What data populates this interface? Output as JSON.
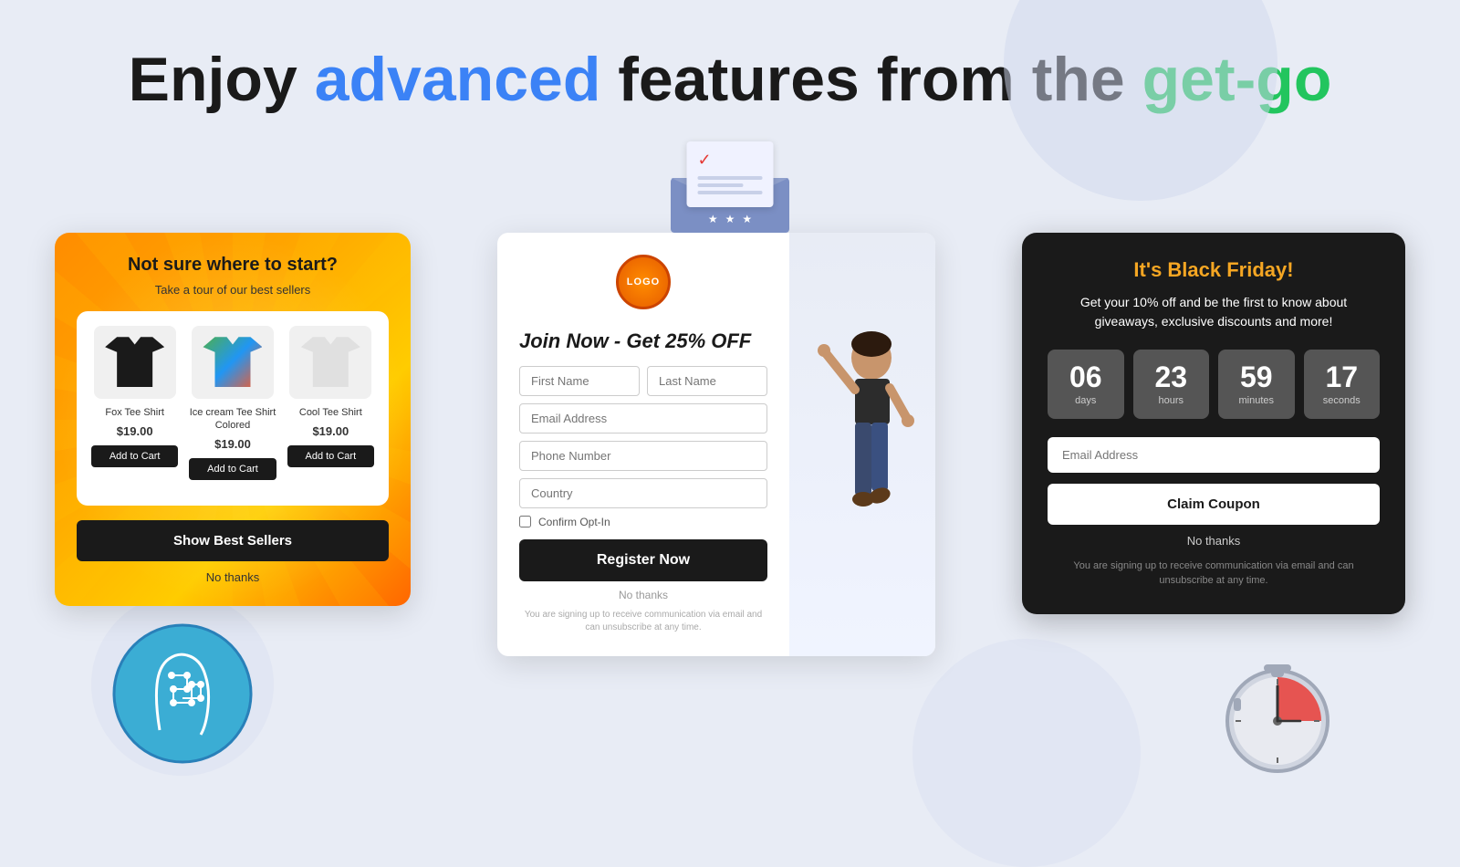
{
  "header": {
    "title_plain": "Enjoy ",
    "title_blue": "advanced",
    "title_mid": " features from the ",
    "title_green": "get-go"
  },
  "left_card": {
    "heading": "Not sure where to start?",
    "subheading": "Take a tour of our best sellers",
    "products": [
      {
        "name": "Fox Tee Shirt",
        "price": "$19.00",
        "color": "black"
      },
      {
        "name": "Ice cream Tee Shirt Colored",
        "price": "$19.00",
        "color": "colorful"
      },
      {
        "name": "Cool Tee Shirt",
        "price": "$19.00",
        "color": "light"
      }
    ],
    "add_to_cart_label": "Add to Cart",
    "show_sellers_label": "Show Best Sellers",
    "no_thanks_label": "No thanks"
  },
  "center_card": {
    "logo_text": "LOGO",
    "title": "Join Now - Get 25% OFF",
    "fields": {
      "first_name": "First Name",
      "last_name": "Last Name",
      "email": "Email Address",
      "phone": "Phone Number",
      "country": "Country"
    },
    "checkbox_label": "Confirm Opt-In",
    "register_label": "Register Now",
    "no_thanks_label": "No thanks",
    "disclaimer": "You are signing up to receive communication via email and can unsubscribe at any time."
  },
  "right_card": {
    "title": "It's Black Friday!",
    "subtitle": "Get your 10% off and be the first to know about giveaways, exclusive discounts and more!",
    "countdown": {
      "days": {
        "value": "06",
        "label": "days"
      },
      "hours": {
        "value": "23",
        "label": "hours"
      },
      "minutes": {
        "value": "59",
        "label": "minutes"
      },
      "seconds": {
        "value": "17",
        "label": "seconds"
      }
    },
    "email_placeholder": "Email Address",
    "claim_label": "Claim Coupon",
    "no_thanks_label": "No thanks",
    "disclaimer": "You are signing up to receive communication via email and can unsubscribe at any time."
  }
}
